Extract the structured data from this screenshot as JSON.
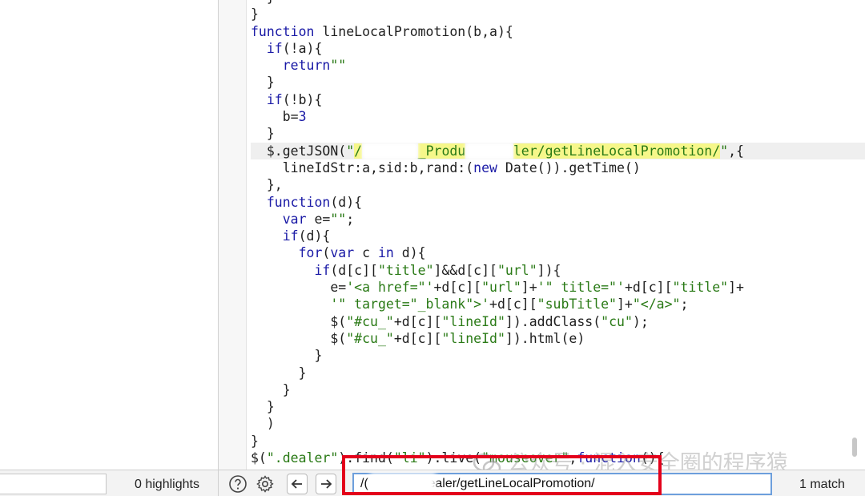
{
  "editor": {
    "lines": [
      [
        {
          "t": "  }",
          "c": ""
        }
      ],
      [
        {
          "t": "}",
          "c": ""
        }
      ],
      [
        {
          "t": "function",
          "c": "kw"
        },
        {
          "t": " lineLocalPromotion(b,a){",
          "c": ""
        }
      ],
      [
        {
          "t": "  ",
          "c": ""
        },
        {
          "t": "if",
          "c": "kw"
        },
        {
          "t": "(!a){",
          "c": ""
        }
      ],
      [
        {
          "t": "    ",
          "c": ""
        },
        {
          "t": "return",
          "c": "kw"
        },
        {
          "t": "\"\"",
          "c": "str"
        }
      ],
      [
        {
          "t": "  }",
          "c": ""
        }
      ],
      [
        {
          "t": "  ",
          "c": ""
        },
        {
          "t": "if",
          "c": "kw"
        },
        {
          "t": "(!b){",
          "c": ""
        }
      ],
      [
        {
          "t": "    b=",
          "c": ""
        },
        {
          "t": "3",
          "c": "num"
        }
      ],
      [
        {
          "t": "  }",
          "c": ""
        }
      ],
      [
        {
          "t": "  $.getJSON(",
          "c": ""
        },
        {
          "t": "\"",
          "c": "str"
        },
        {
          "t": "/",
          "c": "match"
        },
        {
          "t": "       ",
          "c": "blur"
        },
        {
          "t": "_Produ",
          "c": "match"
        },
        {
          "t": "      ",
          "c": "blur"
        },
        {
          "t": "ler/getLineLocalPromotion/",
          "c": "match"
        },
        {
          "t": "\"",
          "c": "str"
        },
        {
          "t": ",{",
          "c": ""
        }
      ],
      [
        {
          "t": "    lineIdStr:a,sid:b,rand:(",
          "c": ""
        },
        {
          "t": "new",
          "c": "kw"
        },
        {
          "t": " Date()).getTime()",
          "c": ""
        }
      ],
      [
        {
          "t": "  },",
          "c": ""
        }
      ],
      [
        {
          "t": "  ",
          "c": ""
        },
        {
          "t": "function",
          "c": "kw"
        },
        {
          "t": "(d){",
          "c": ""
        }
      ],
      [
        {
          "t": "    ",
          "c": ""
        },
        {
          "t": "var",
          "c": "kw"
        },
        {
          "t": " e=",
          "c": ""
        },
        {
          "t": "\"\"",
          "c": "str"
        },
        {
          "t": ";",
          "c": ""
        }
      ],
      [
        {
          "t": "    ",
          "c": ""
        },
        {
          "t": "if",
          "c": "kw"
        },
        {
          "t": "(d){",
          "c": ""
        }
      ],
      [
        {
          "t": "      ",
          "c": ""
        },
        {
          "t": "for",
          "c": "kw"
        },
        {
          "t": "(",
          "c": ""
        },
        {
          "t": "var",
          "c": "kw"
        },
        {
          "t": " c ",
          "c": ""
        },
        {
          "t": "in",
          "c": "kw"
        },
        {
          "t": " d){",
          "c": ""
        }
      ],
      [
        {
          "t": "        ",
          "c": ""
        },
        {
          "t": "if",
          "c": "kw"
        },
        {
          "t": "(d[c][",
          "c": ""
        },
        {
          "t": "\"title\"",
          "c": "str"
        },
        {
          "t": "]&&d[c][",
          "c": ""
        },
        {
          "t": "\"url\"",
          "c": "str"
        },
        {
          "t": "]){",
          "c": ""
        }
      ],
      [
        {
          "t": "          e=",
          "c": ""
        },
        {
          "t": "'<a href=\"'",
          "c": "str"
        },
        {
          "t": "+d[c][",
          "c": ""
        },
        {
          "t": "\"url\"",
          "c": "str"
        },
        {
          "t": "]+",
          "c": ""
        },
        {
          "t": "'\" title=\"'",
          "c": "str"
        },
        {
          "t": "+d[c][",
          "c": ""
        },
        {
          "t": "\"title\"",
          "c": "str"
        },
        {
          "t": "]+",
          "c": ""
        }
      ],
      [
        {
          "t": "          ",
          "c": ""
        },
        {
          "t": "'\" target=\"_blank\">'",
          "c": "str"
        },
        {
          "t": "+d[c][",
          "c": ""
        },
        {
          "t": "\"subTitle\"",
          "c": "str"
        },
        {
          "t": "]+",
          "c": ""
        },
        {
          "t": "\"</a>\"",
          "c": "str"
        },
        {
          "t": ";",
          "c": ""
        }
      ],
      [
        {
          "t": "          $(",
          "c": ""
        },
        {
          "t": "\"#cu_\"",
          "c": "str"
        },
        {
          "t": "+d[c][",
          "c": ""
        },
        {
          "t": "\"lineId\"",
          "c": "str"
        },
        {
          "t": "]).addClass(",
          "c": ""
        },
        {
          "t": "\"cu\"",
          "c": "str"
        },
        {
          "t": ");",
          "c": ""
        }
      ],
      [
        {
          "t": "          $(",
          "c": ""
        },
        {
          "t": "\"#cu_\"",
          "c": "str"
        },
        {
          "t": "+d[c][",
          "c": ""
        },
        {
          "t": "\"lineId\"",
          "c": "str"
        },
        {
          "t": "]).html(e)",
          "c": ""
        }
      ],
      [
        {
          "t": "        }",
          "c": ""
        }
      ],
      [
        {
          "t": "      }",
          "c": ""
        }
      ],
      [
        {
          "t": "    }",
          "c": ""
        }
      ],
      [
        {
          "t": "  }",
          "c": ""
        }
      ],
      [
        {
          "t": "  )",
          "c": ""
        }
      ],
      [
        {
          "t": "}",
          "c": ""
        }
      ],
      [
        {
          "t": "$(",
          "c": ""
        },
        {
          "t": "\".dealer\"",
          "c": "str"
        },
        {
          "t": ").find(",
          "c": ""
        },
        {
          "t": "\"li\"",
          "c": "str"
        },
        {
          "t": ").live(",
          "c": ""
        },
        {
          "t": "\"mouseover\"",
          "c": "str"
        },
        {
          "t": ",",
          "c": ""
        },
        {
          "t": "function",
          "c": "kw"
        },
        {
          "t": "(){",
          "c": ""
        }
      ]
    ],
    "current_line_index": 9
  },
  "watermark": "公众号 · 混入安全圈的程序猿",
  "bottom_bar": {
    "highlights_label": "0 highlights",
    "search_value": "/(          uctdealer/getLineLocalPromotion/",
    "match_count": "1 match",
    "icons": [
      "help-icon",
      "gear-icon",
      "arrow-left-icon",
      "arrow-right-icon"
    ]
  },
  "colors": {
    "keyword": "#1a1aa6",
    "string": "#2a7a16",
    "match_highlight": "#f6f78a",
    "annotation_box": "#e3001b"
  }
}
